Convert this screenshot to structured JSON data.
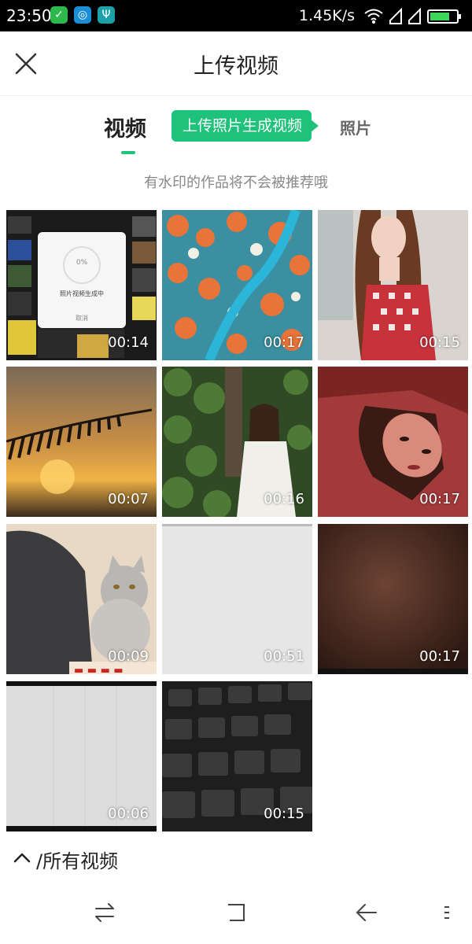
{
  "status_bar": {
    "time": "23:50",
    "network_speed": "1.45K/s",
    "app_icons": [
      "wechat-icon",
      "browser-icon",
      "usb-icon"
    ],
    "status_icons": [
      "wifi-icon",
      "signal-icon",
      "signal-icon",
      "battery-icon"
    ]
  },
  "header": {
    "title": "上传视频",
    "close_icon": "close-icon"
  },
  "tabs": {
    "video": "视频",
    "badge": "上传照片生成视频",
    "photo": "照片",
    "active": "video"
  },
  "hint": "有水印的作品将不会被推荐哦",
  "progress_dialog": {
    "percent": "0%",
    "text": "照片视频生成中",
    "cancel": "取消"
  },
  "videos": [
    {
      "duration": "00:14"
    },
    {
      "duration": "00:17"
    },
    {
      "duration": "00:15"
    },
    {
      "duration": "00:07"
    },
    {
      "duration": "00:16"
    },
    {
      "duration": "00:17"
    },
    {
      "duration": "00:09"
    },
    {
      "duration": "00:51"
    },
    {
      "duration": "00:17"
    },
    {
      "duration": "00:06"
    },
    {
      "duration": "00:15"
    }
  ],
  "filter": {
    "label": "/所有视频",
    "icon": "chevron-up-icon"
  },
  "nav_bar": {
    "icons": [
      "switch-icon",
      "home-icon",
      "back-icon",
      "menu-icon"
    ]
  },
  "colors": {
    "accent": "#1ec27a",
    "status_bar_bg": "#000000"
  }
}
